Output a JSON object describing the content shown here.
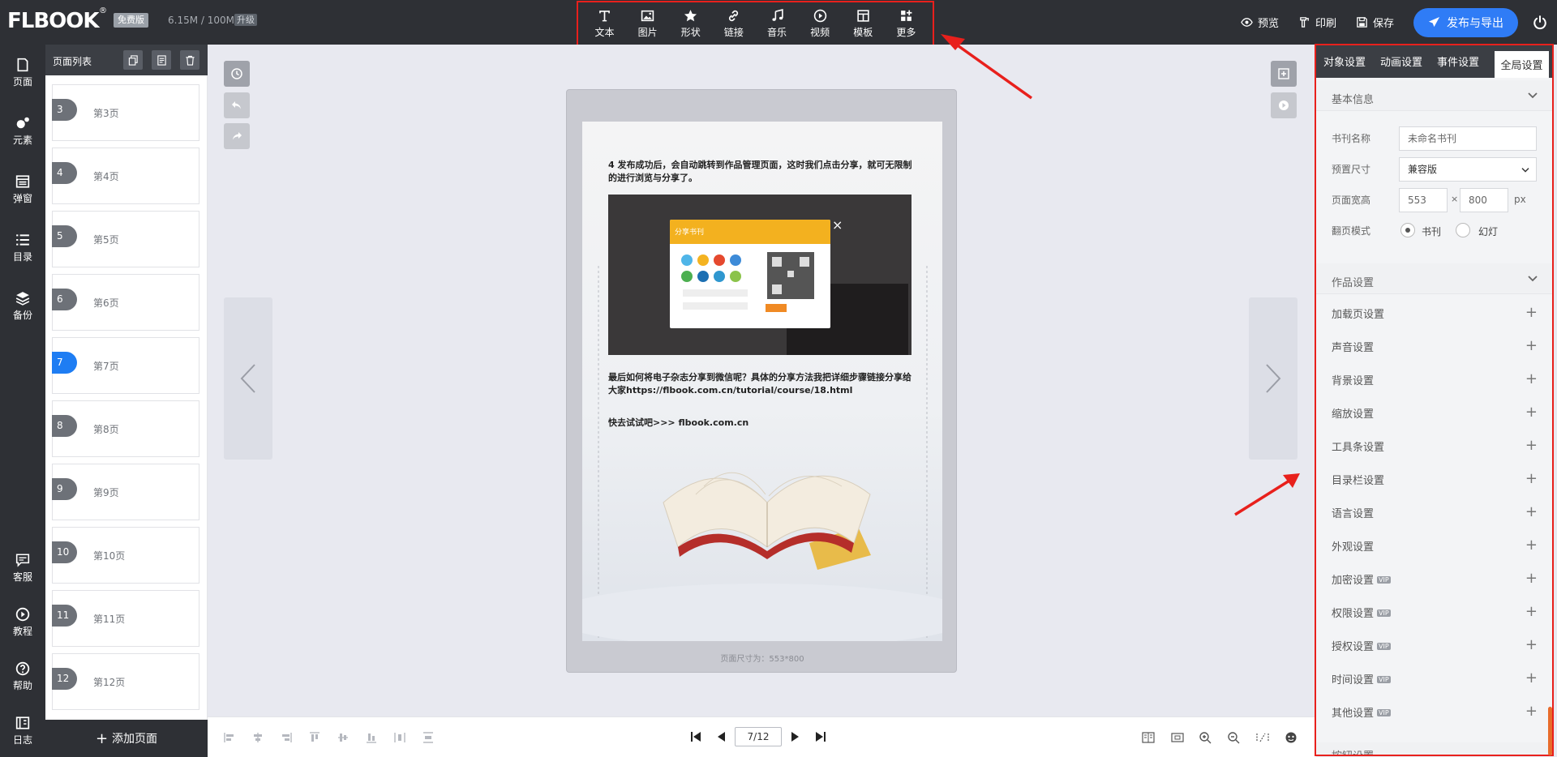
{
  "header": {
    "logo": "FLBOOK",
    "plan_badge": "免费版",
    "storage": "6.15M / 100M",
    "upgrade": "升级"
  },
  "toolbar": [
    {
      "label": "文本",
      "icon": "text-icon"
    },
    {
      "label": "图片",
      "icon": "image-icon"
    },
    {
      "label": "形状",
      "icon": "star-icon"
    },
    {
      "label": "链接",
      "icon": "link-icon"
    },
    {
      "label": "音乐",
      "icon": "music-icon"
    },
    {
      "label": "视频",
      "icon": "video-icon"
    },
    {
      "label": "模板",
      "icon": "template-icon"
    },
    {
      "label": "更多",
      "icon": "grid-plus-icon"
    }
  ],
  "actions": {
    "preview": "预览",
    "print": "印刷",
    "save": "保存",
    "publish": "发布与导出"
  },
  "leftnav": [
    {
      "label": "页面",
      "icon": "page-icon"
    },
    {
      "label": "元素",
      "icon": "elements-icon"
    },
    {
      "label": "弹窗",
      "icon": "popup-icon"
    },
    {
      "label": "目录",
      "icon": "list-icon"
    },
    {
      "label": "备份",
      "icon": "layers-icon"
    },
    {
      "label": "客服",
      "icon": "chat-icon"
    },
    {
      "label": "教程",
      "icon": "play-icon"
    },
    {
      "label": "帮助",
      "icon": "help-icon"
    },
    {
      "label": "日志",
      "icon": "log-icon"
    }
  ],
  "pagelist": {
    "title": "页面列表",
    "add_page": "添加页面",
    "active": 7,
    "pages": [
      {
        "num": "3",
        "label": "第3页"
      },
      {
        "num": "4",
        "label": "第4页"
      },
      {
        "num": "5",
        "label": "第5页"
      },
      {
        "num": "6",
        "label": "第6页"
      },
      {
        "num": "7",
        "label": "第7页"
      },
      {
        "num": "8",
        "label": "第8页"
      },
      {
        "num": "9",
        "label": "第9页"
      },
      {
        "num": "10",
        "label": "第10页"
      },
      {
        "num": "11",
        "label": "第11页"
      },
      {
        "num": "12",
        "label": "第12页"
      }
    ]
  },
  "page_content": {
    "step_text": "4 发布成功后，会自动跳转到作品管理页面，这时我们点击分享，就可无限制的进行浏览与分享了。",
    "share_dialog_title": "分享书刊",
    "share_button": "复制链接",
    "wechat_text": "最后如何将电子杂志分享到微信呢？具体的分享方法我把详细步骤链接分享给大家https://flbook.com.cn/tutorial/course/18.html",
    "try_text": "快去试试吧>>> flbook.com.cn"
  },
  "page_size_note": "页面尺寸为：553*800",
  "pager": {
    "value": "7/12"
  },
  "rightpanel": {
    "tabs": [
      "对象设置",
      "动画设置",
      "事件设置",
      "全局设置"
    ],
    "active_tab": 3,
    "basic_info": "基本信息",
    "book_name_label": "书刊名称",
    "book_name_placeholder": "未命名书刊",
    "preset_size_label": "预置尺寸",
    "preset_size_value": "兼容版",
    "page_size_label": "页面宽高",
    "width": "553",
    "times": "×",
    "height": "800",
    "unit": "px",
    "flip_mode_label": "翻页模式",
    "flip_book": "书刊",
    "flip_slide": "幻灯",
    "work_settings": "作品设置",
    "rows": [
      {
        "label": "加载页设置",
        "vip": false
      },
      {
        "label": "声音设置",
        "vip": false
      },
      {
        "label": "背景设置",
        "vip": false
      },
      {
        "label": "缩放设置",
        "vip": false
      },
      {
        "label": "工具条设置",
        "vip": false
      },
      {
        "label": "目录栏设置",
        "vip": false
      },
      {
        "label": "语言设置",
        "vip": false
      },
      {
        "label": "外观设置",
        "vip": false
      },
      {
        "label": "加密设置",
        "vip": true
      },
      {
        "label": "权限设置",
        "vip": true
      },
      {
        "label": "授权设置",
        "vip": true
      },
      {
        "label": "时间设置",
        "vip": true
      },
      {
        "label": "其他设置",
        "vip": true
      }
    ],
    "vip_text": "VIP",
    "cut_off": "按钮设置"
  },
  "colors": {
    "accent": "#2f7cf6",
    "highlight": "#e8201c",
    "dark": "#2e3035"
  }
}
